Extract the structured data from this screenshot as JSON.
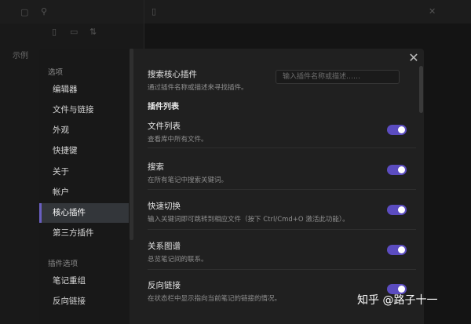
{
  "background": {
    "left_label": "示例"
  },
  "settings_modal": {
    "sidebar": {
      "options_header": "选项",
      "items": [
        {
          "label": "编辑器"
        },
        {
          "label": "文件与链接"
        },
        {
          "label": "外观"
        },
        {
          "label": "快捷键"
        },
        {
          "label": "关于"
        },
        {
          "label": "帐户"
        },
        {
          "label": "核心插件",
          "active": true
        },
        {
          "label": "第三方插件"
        }
      ],
      "plugin_options_header": "插件选项",
      "plugin_items": [
        {
          "label": "笔记重组"
        },
        {
          "label": "反向链接"
        }
      ]
    },
    "search": {
      "title": "搜索核心插件",
      "description": "通过插件名称或描述来寻找插件。",
      "placeholder": "输入插件名称或描述……"
    },
    "section_title": "插件列表",
    "plugins": [
      {
        "name": "文件列表",
        "description": "查看库中所有文件。",
        "enabled": true
      },
      {
        "name": "搜索",
        "description": "在所有笔记中搜索关键词。",
        "enabled": true
      },
      {
        "name": "快速切换",
        "description": "输入关键词即可跳转到相应文件（按下 Ctrl/Cmd+O 激活此功能）。",
        "enabled": true
      },
      {
        "name": "关系图谱",
        "description": "总览笔记间的联系。",
        "enabled": true
      },
      {
        "name": "反向链接",
        "description": "在状态栏中显示指向当前笔记的链接的情况。",
        "enabled": true
      }
    ],
    "accent_color": "#5b4cc0"
  },
  "watermark": "知乎 @路子十一"
}
